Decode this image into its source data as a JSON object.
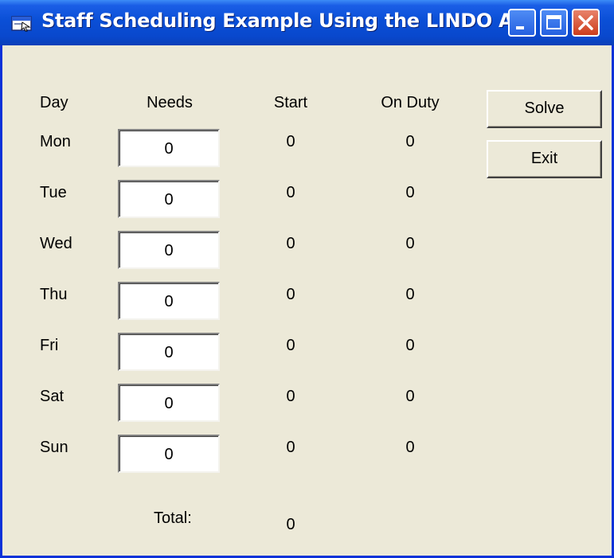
{
  "window": {
    "title": "Staff Scheduling Example Using the LINDO API"
  },
  "headers": {
    "day": "Day",
    "needs": "Needs",
    "start": "Start",
    "on_duty": "On Duty"
  },
  "rows": [
    {
      "day": "Mon",
      "needs": "0",
      "start": "0",
      "on_duty": "0"
    },
    {
      "day": "Tue",
      "needs": "0",
      "start": "0",
      "on_duty": "0"
    },
    {
      "day": "Wed",
      "needs": "0",
      "start": "0",
      "on_duty": "0"
    },
    {
      "day": "Thu",
      "needs": "0",
      "start": "0",
      "on_duty": "0"
    },
    {
      "day": "Fri",
      "needs": "0",
      "start": "0",
      "on_duty": "0"
    },
    {
      "day": "Sat",
      "needs": "0",
      "start": "0",
      "on_duty": "0"
    },
    {
      "day": "Sun",
      "needs": "0",
      "start": "0",
      "on_duty": "0"
    }
  ],
  "total": {
    "label": "Total:",
    "value": "0"
  },
  "buttons": {
    "solve": "Solve",
    "exit": "Exit"
  },
  "icons": {
    "app": "app-window-icon",
    "minimize": "minimize-icon",
    "maximize": "maximize-icon",
    "close": "close-icon"
  },
  "colors": {
    "titlebar": "#0a4fd6",
    "window_bg": "#ece9d8",
    "close_button": "#cc3d1c"
  }
}
